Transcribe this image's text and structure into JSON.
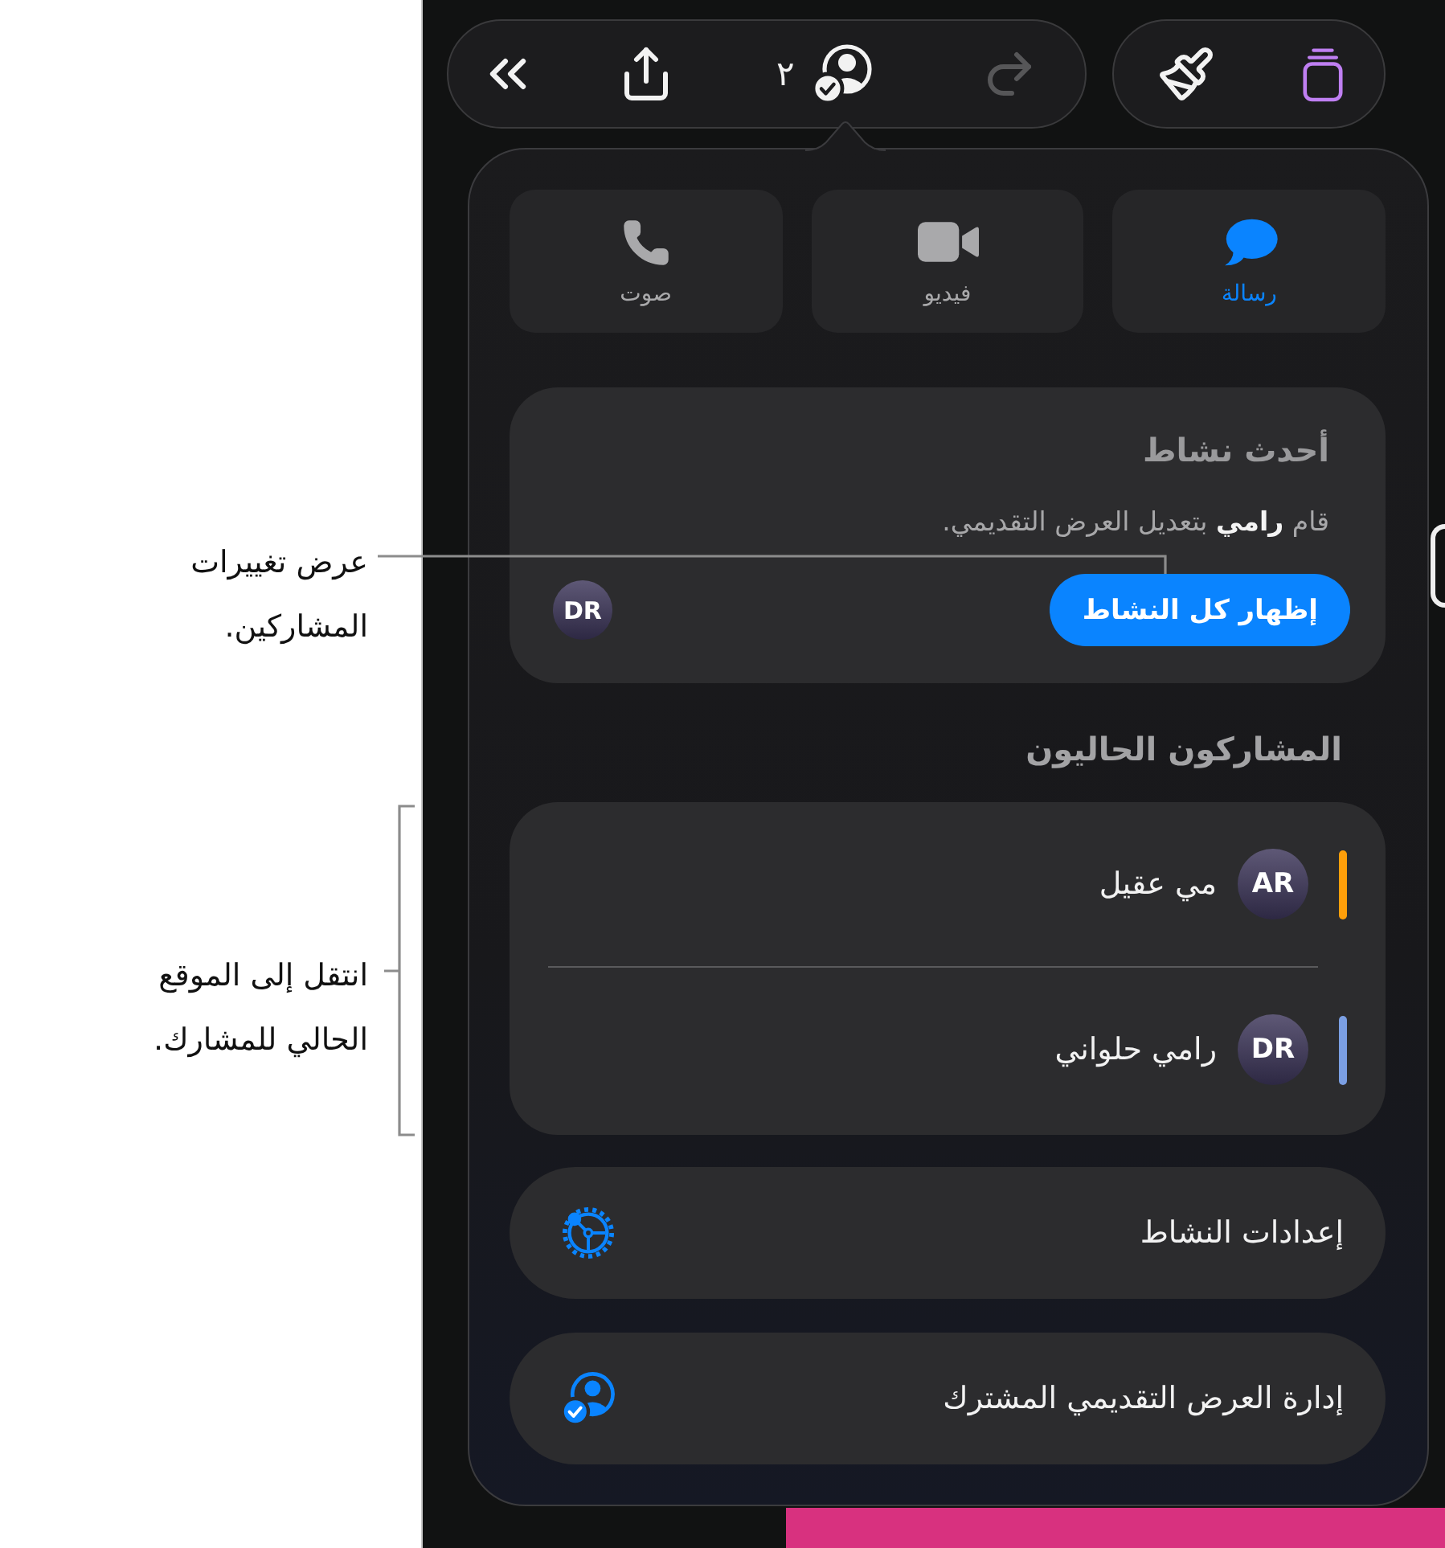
{
  "callouts": [
    {
      "text": "عرض تغييرات\nالمشاركين."
    },
    {
      "text": "انتقل إلى الموقع\nالحالي للمشارك."
    }
  ],
  "toolbar": {
    "groups": [
      {
        "buttons": [
          {
            "disabled": false
          },
          {
            "disabled": false
          },
          {
            "count": "٢",
            "disabled": false
          },
          {
            "disabled": true
          }
        ]
      },
      {
        "buttons": [
          {
            "color": "#f2f2f2"
          },
          {
            "color": "#bf7ff2"
          }
        ]
      }
    ]
  },
  "contact_buttons": [
    {
      "label": "رسالة",
      "selected": true
    },
    {
      "label": "فيديو",
      "selected": false
    },
    {
      "label": "صوت",
      "selected": false
    }
  ],
  "activity": {
    "title": "أحدث نشاط",
    "text": "قام **رامي** بتعديل العرض التقديمي.",
    "button": "إظهار كل النشاط",
    "avatars": [
      {
        "initials": "DR"
      }
    ]
  },
  "participants": {
    "title": "المشاركون الحاليون",
    "items": [
      {
        "name": "مي عقيل",
        "initials": "AR",
        "color": "#ff9f0a"
      },
      {
        "name": "رامي حلواني",
        "initials": "DR",
        "color": "#7b9fe3"
      }
    ]
  },
  "menu": [
    {
      "label": "إعدادات النشاط"
    },
    {
      "label": "إدارة العرض التقديمي المشترك"
    }
  ]
}
